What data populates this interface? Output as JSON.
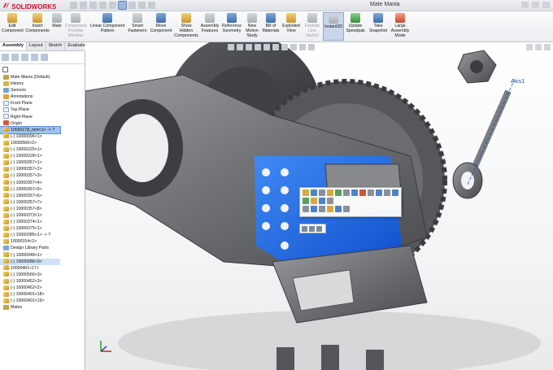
{
  "app": {
    "name": "SOLIDWORKS",
    "document_title": "Mate Mania"
  },
  "colors": {
    "brand": "#c8102e",
    "selection": "#1c6df0",
    "tree_select": "#9fc3ee",
    "axis_label": "#1d4fa8"
  },
  "toolbar": {
    "edit_component": "Edit Component",
    "insert_components": "Insert Components",
    "mate": "Mate",
    "component_preview": "Component Preview Window",
    "linear_pattern": "Linear Component Pattern",
    "smart_fasteners": "Smart Fasteners",
    "move_component": "Move Component",
    "show_hidden": "Show Hidden Components",
    "assembly_features": "Assembly Features",
    "reference_geometry": "Reference Geometry",
    "new_motion_study": "New Motion Study",
    "bill_of_materials": "Bill of Materials",
    "exploded_view": "Exploded View",
    "explode_line_sketch": "Explode Line Sketch",
    "instant3d": "Instant3D",
    "update_speedpak": "Update Speedpak",
    "take_snapshot": "Take Snapshot",
    "large_assembly_mode": "Large Assembly Mode"
  },
  "tabs": [
    "Assembly",
    "Layout",
    "Sketch",
    "Evaluate"
  ],
  "tree": {
    "root": "Mate Mania  (Default)",
    "history": "History",
    "sensors": "Sensors",
    "annotations": "Annotations",
    "front_plane": "Front Plane",
    "top_plane": "Top Plane",
    "right_plane": "Right Plane",
    "origin": "Origin",
    "parts": [
      "10000178_mm<1> -> ?",
      "(-) 10000096<1>",
      "10000566<2>",
      "(-) 10000225<1>",
      "(-) 10000228<1>",
      "(-) 10000357<1>",
      "(-) 10000357<2>",
      "(-) 10000357<3>",
      "(-) 10000357<4>",
      "(-) 10000357<5>",
      "(-) 10000357<6>",
      "(-) 10000357<7>",
      "(-) 10000357<8>",
      "(-) 10000373<1>",
      "(-) 10000374<1>",
      "(-) 10000375<1>",
      "(-) 10000385<1> -> ?",
      "10000154<2>"
    ],
    "design_library": "Design Library Parts",
    "library_parts": [
      "(-) 10000048<1>",
      "(-) 10000086<3>",
      "10000401<17>",
      "(-) 10000566<3>",
      "(-) 10000452<3>",
      "(-) 10000452<2>",
      "(-) 10000401<18>",
      "(-) 10000401<19>"
    ],
    "mates": "Mates"
  },
  "viewport": {
    "axis_label": "Axis1"
  }
}
